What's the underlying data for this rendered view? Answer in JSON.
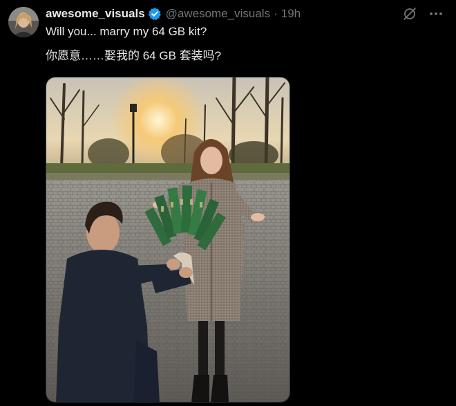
{
  "tweet": {
    "author": {
      "display_name": "awesome_visuals",
      "handle": "@awesome_visuals",
      "verified": true,
      "avatar_icon": "user-avatar"
    },
    "separator": "·",
    "timestamp": "19h",
    "text_line1": "Will you... marry my 64 GB kit?",
    "text_line2": "你愿意……娶我的 64 GB 套装吗?",
    "actions": [
      {
        "icon": "grok-icon"
      },
      {
        "icon": "more-options-icon"
      }
    ],
    "media": {
      "type": "photo",
      "icon": "proposal-photo"
    }
  },
  "colors": {
    "background": "#000000",
    "primary_text": "#e7e9ea",
    "secondary_text": "#71767b",
    "verified_blue": "#1d9bf0"
  }
}
